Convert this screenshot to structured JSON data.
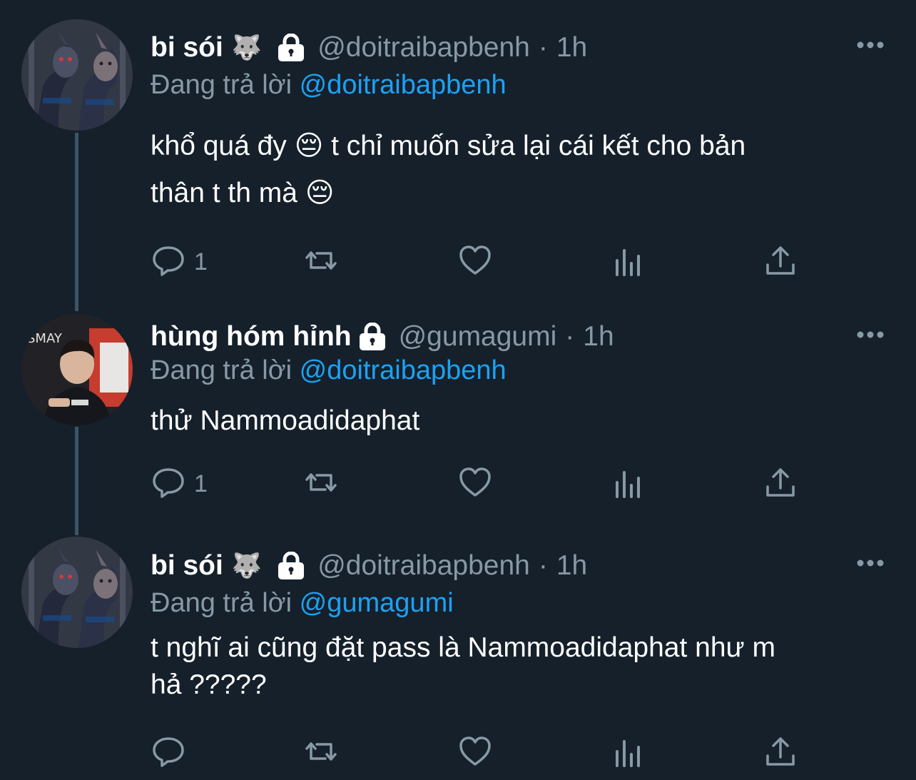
{
  "tweets": [
    {
      "display_name": "bi sói",
      "name_emoji": "🐺",
      "handle": "@doitraibapbenh",
      "separator": "·",
      "time": "1h",
      "replying_prefix": "Đang trả lời",
      "replying_to": "@doitraibapbenh",
      "text_line1": "khổ quá đy 😔  t chỉ muốn sửa lại cái kết cho bản",
      "text_line2": "thân t th mà 😔",
      "reply_count": "1",
      "avatar_icon": "wolf-avatar-icon"
    },
    {
      "display_name": "hùng hóm hỉnh",
      "handle": "@gumagumi",
      "separator": "·",
      "time": "1h",
      "replying_prefix": "Đang trả lời",
      "replying_to": "@doitraibapbenh",
      "text_line1": "thử Nammoadidaphat",
      "reply_count": "1",
      "avatar_icon": "person-avatar-icon"
    },
    {
      "display_name": "bi sói",
      "name_emoji": "🐺",
      "handle": "@doitraibapbenh",
      "separator": "·",
      "time": "1h",
      "replying_prefix": "Đang trả lời",
      "replying_to": "@gumagumi",
      "text_line1": "t nghĩ ai cũng đặt pass là Nammoadidaphat như m",
      "text_line2": "hả ?????",
      "reply_count": "",
      "avatar_icon": "wolf-avatar-icon"
    }
  ],
  "icons": {
    "reply": "reply-icon",
    "retweet": "retweet-icon",
    "like": "heart-icon",
    "analytics": "analytics-icon",
    "share": "share-icon",
    "more": "more-icon",
    "lock": "lock-icon"
  },
  "colors": {
    "background": "#15202b",
    "text": "#ffffff",
    "secondary": "#8899a6",
    "accent": "#1da1f2",
    "thread_line": "#3d5466"
  }
}
